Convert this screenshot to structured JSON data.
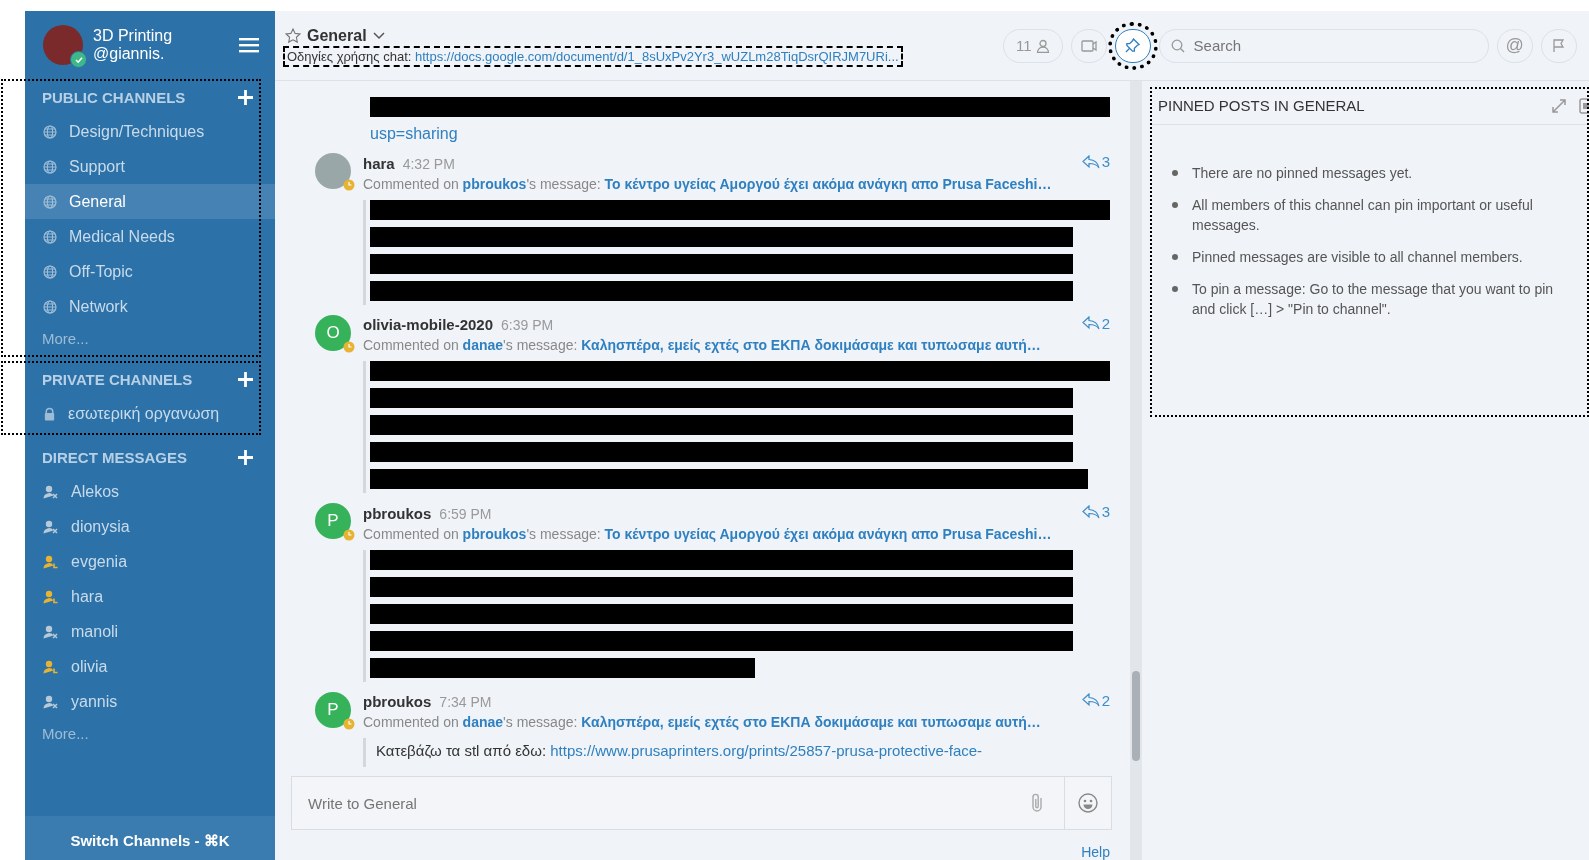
{
  "sidebar": {
    "team": "3D Printing",
    "user": "@giannis.",
    "online": true,
    "sections": [
      {
        "title": "PUBLIC CHANNELS",
        "highlighted": true,
        "more": "More...",
        "items": [
          {
            "label": "Design/Techniques",
            "kind": "public",
            "selected": false
          },
          {
            "label": "Support",
            "kind": "public",
            "selected": false
          },
          {
            "label": "General",
            "kind": "public",
            "selected": true
          },
          {
            "label": "Medical Needs",
            "kind": "public",
            "selected": false
          },
          {
            "label": "Off-Topic",
            "kind": "public",
            "selected": false
          },
          {
            "label": "Network",
            "kind": "public",
            "selected": false
          }
        ]
      },
      {
        "title": "PRIVATE CHANNELS",
        "highlighted": true,
        "items": [
          {
            "label": "εσωτερική οργανωση",
            "kind": "private",
            "selected": false
          }
        ]
      },
      {
        "title": "DIRECT MESSAGES",
        "highlighted": false,
        "more": "More...",
        "items": [
          {
            "label": "Alekos",
            "kind": "direct",
            "away": false,
            "selected": false
          },
          {
            "label": "dionysia",
            "kind": "direct",
            "away": false,
            "selected": false
          },
          {
            "label": "evgenia",
            "kind": "direct",
            "away": true,
            "selected": false
          },
          {
            "label": "hara",
            "kind": "direct",
            "away": true,
            "selected": false
          },
          {
            "label": "manoli",
            "kind": "direct",
            "away": false,
            "selected": false
          },
          {
            "label": "olivia",
            "kind": "direct",
            "away": true,
            "selected": false
          },
          {
            "label": "yannis",
            "kind": "direct",
            "away": false,
            "selected": false
          }
        ]
      }
    ],
    "switch_channels": "Switch Channels - ⌘K"
  },
  "channel_header": {
    "name": "General",
    "favorite": false,
    "topic_label": "Οδηγίες χρήσης chat:",
    "topic_link": "https://docs.google.com/document/d/1_8sUxPv2Yr3_wUZLm28TiqDsrQIRJM7URi...",
    "topic_highlighted": true,
    "member_count": "11",
    "pinned_active": true,
    "pinned_highlighted": true,
    "search": {
      "placeholder": "Search"
    },
    "mention_button": "@"
  },
  "posts": [
    {
      "kind": "continuation",
      "redacted_lines": [
        {
          "kind": "full"
        }
      ],
      "link": "usp=sharing"
    },
    {
      "kind": "comment",
      "user": "hara",
      "avatar": {
        "kind": "photo"
      },
      "away": true,
      "time": "4:32 PM",
      "replies": "3",
      "author": "pbroukos",
      "message_suffix": "'s message:",
      "prefix": "Commented on",
      "thread": "Το κέντρο υγείας Αμοργού έχει ακόμα ανάγκη απο Prusa Faceshi…",
      "redacted_lines": [
        {
          "kind": "full"
        },
        {
          "kind": "wide"
        },
        {
          "kind": "wide"
        },
        {
          "kind": "wide"
        }
      ]
    },
    {
      "kind": "comment",
      "user": "olivia-mobile-2020",
      "avatar": {
        "kind": "letter",
        "initial": "O"
      },
      "away": true,
      "time": "6:39 PM",
      "replies": "2",
      "author": "danae",
      "message_suffix": "'s message:",
      "prefix": "Commented on",
      "thread": "Καλησπέρα, εμείς εχτές στο ΕΚΠΑ δοκιμάσαμε και τυπωσαμε αυτή…",
      "redacted_lines": [
        {
          "kind": "full"
        },
        {
          "kind": "wide"
        },
        {
          "kind": "wide"
        },
        {
          "kind": "wide"
        },
        {
          "kind": "short"
        }
      ]
    },
    {
      "kind": "comment",
      "user": "pbroukos",
      "avatar": {
        "kind": "letter",
        "initial": "P"
      },
      "away": true,
      "time": "6:59 PM",
      "replies": "3",
      "author": "pbroukos",
      "message_suffix": "'s message:",
      "prefix": "Commented on",
      "thread": "Το κέντρο υγείας Αμοργού έχει ακόμα ανάγκη απο Prusa Faceshi…",
      "redacted_lines": [
        {
          "kind": "wide"
        },
        {
          "kind": "wide"
        },
        {
          "kind": "wide"
        },
        {
          "kind": "wide"
        },
        {
          "kind": "half"
        }
      ]
    },
    {
      "kind": "comment",
      "user": "pbroukos",
      "avatar": {
        "kind": "letter",
        "initial": "P"
      },
      "away": true,
      "time": "7:34 PM",
      "replies": "2",
      "author": "danae",
      "message_suffix": "'s message:",
      "prefix": "Commented on",
      "thread": "Καλησπέρα, εμείς εχτές στο ΕΚΠΑ δοκιμάσαμε και τυπωσαμε αυτή…",
      "text": "Κατεβάζω τα stl από εδω:",
      "text_link": "https://www.prusaprinters.org/prints/25857-prusa-protective-face-"
    }
  ],
  "input": {
    "placeholder": "Write to General"
  },
  "help": "Help",
  "pinned_panel": {
    "title": "PINNED POSTS IN GENERAL",
    "highlighted": true,
    "items": [
      "There are no pinned messages yet.",
      "All members of this channel can pin important or useful messages.",
      "Pinned messages are visible to all channel members.",
      "To pin a message: Go to the message that you want to pin and click […] > \"Pin to channel\"."
    ]
  }
}
